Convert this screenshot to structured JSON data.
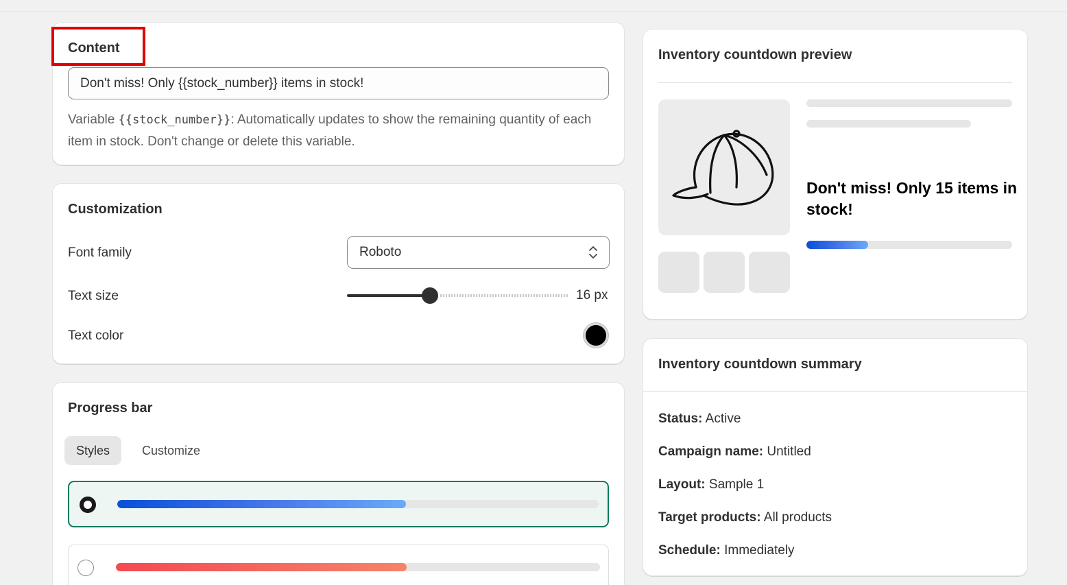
{
  "content": {
    "title": "Content",
    "input_value": "Don't miss! Only {{stock_number}} items in stock!",
    "help_prefix": "Variable ",
    "help_code": "{{stock_number}}",
    "help_suffix": ": Automatically updates to show the remaining quantity of each item in stock. Don't change or delete this variable."
  },
  "customization": {
    "title": "Customization",
    "font_family_label": "Font family",
    "font_family_value": "Roboto",
    "text_size_label": "Text size",
    "text_size_value": "16 px",
    "text_size_level": 0.37,
    "text_color_label": "Text color",
    "text_color": "#000000"
  },
  "progress_bar": {
    "title": "Progress bar",
    "tabs": [
      {
        "label": "Styles",
        "active": true
      },
      {
        "label": "Customize",
        "active": false
      }
    ],
    "options": [
      {
        "style": "blue-gradient",
        "selected": true,
        "fill": 0.6
      },
      {
        "style": "red-gradient",
        "selected": false,
        "fill": 0.6
      }
    ]
  },
  "preview": {
    "title": "Inventory countdown preview",
    "message": "Don't miss! Only 15 items in stock!",
    "progress_fill": 0.3,
    "image_icon": "baseball-cap-icon"
  },
  "summary": {
    "title": "Inventory countdown summary",
    "rows": [
      {
        "label": "Status:",
        "value": "Active"
      },
      {
        "label": "Campaign name:",
        "value": "Untitled"
      },
      {
        "label": "Layout:",
        "value": "Sample 1"
      },
      {
        "label": "Target products:",
        "value": "All products"
      },
      {
        "label": "Schedule:",
        "value": "Immediately"
      }
    ]
  },
  "colors": {
    "highlight": "#e00000",
    "selected_border": "#0b7a5e",
    "bar_blue": "#0a4fd8",
    "bar_red": "#f44a52"
  }
}
